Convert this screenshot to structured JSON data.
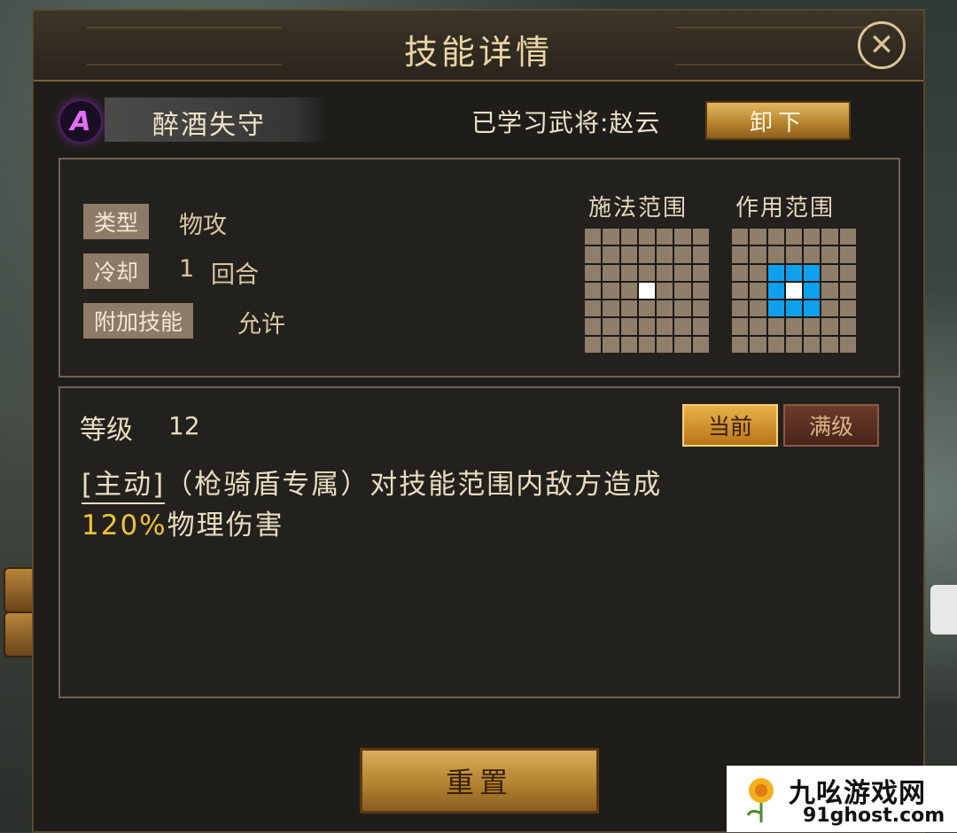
{
  "title": "技能详情",
  "skill": {
    "name": "醉酒失守",
    "icon_letter": "A",
    "learned_by": "已学习武将:赵云",
    "unload_label": "卸下"
  },
  "info": {
    "type_label": "类型",
    "type_value": "物攻",
    "cooldown_label": "冷却",
    "cooldown_value": "1",
    "cooldown_unit": "回合",
    "extra_label": "附加技能",
    "extra_value": "允许",
    "cast_range_label": "施法范围",
    "effect_range_label": "作用范围"
  },
  "cast_range": {
    "size": 7,
    "highlight_center": true,
    "center_color": "#ffffff"
  },
  "effect_range": {
    "size": 7,
    "area_radius": 1,
    "area_color": "#0ea0ec",
    "center_color": "#ffffff"
  },
  "level": {
    "label": "等级",
    "value": "12",
    "tab_current": "当前",
    "tab_max": "满级",
    "active_tab": "当前"
  },
  "description": {
    "tag": "[主动]",
    "text1": "（枪骑盾专属）对技能范围内敌方造成",
    "percent": "120%",
    "text2": "物理伤害"
  },
  "reset_label": "重置",
  "watermark": {
    "title": "九吆游戏网",
    "url": "91ghost.com"
  }
}
